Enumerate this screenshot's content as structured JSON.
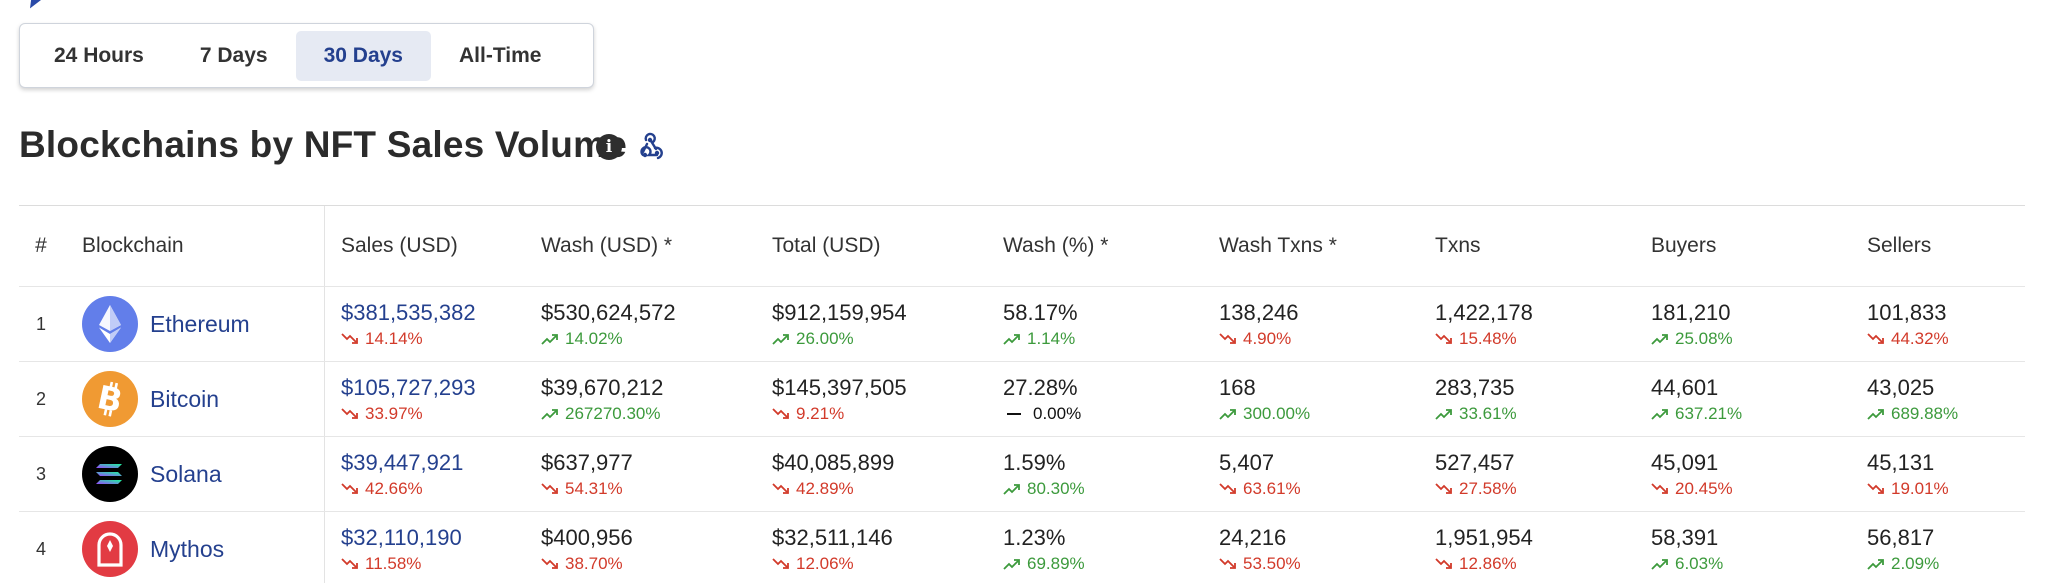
{
  "range_tabs": [
    {
      "label": "24 Hours",
      "active": false
    },
    {
      "label": "7 Days",
      "active": false
    },
    {
      "label": "30 Days",
      "active": true
    },
    {
      "label": "All-Time",
      "active": false
    }
  ],
  "section": {
    "title": "Blockchains by NFT Sales Volume",
    "info_icon": "info-icon",
    "webhook_icon": "webhook-icon"
  },
  "table": {
    "headers": {
      "rank": "#",
      "blockchain": "Blockchain",
      "sales": "Sales (USD)",
      "wash": "Wash (USD) *",
      "total": "Total (USD)",
      "wash_pct": "Wash (%) *",
      "wash_txns": "Wash Txns *",
      "txns": "Txns",
      "buyers": "Buyers",
      "sellers": "Sellers"
    },
    "rows": [
      {
        "rank": "1",
        "name": "Ethereum",
        "icon": "ethereum-icon",
        "color": "#627eea",
        "sales": {
          "v": "$381,535,382",
          "c": "14.14%",
          "d": "down"
        },
        "wash": {
          "v": "$530,624,572",
          "c": "14.02%",
          "d": "up"
        },
        "total": {
          "v": "$912,159,954",
          "c": "26.00%",
          "d": "up"
        },
        "wash_pct": {
          "v": "58.17%",
          "c": "1.14%",
          "d": "up"
        },
        "wash_txns": {
          "v": "138,246",
          "c": "4.90%",
          "d": "down"
        },
        "txns": {
          "v": "1,422,178",
          "c": "15.48%",
          "d": "down"
        },
        "buyers": {
          "v": "181,210",
          "c": "25.08%",
          "d": "up"
        },
        "sellers": {
          "v": "101,833",
          "c": "44.32%",
          "d": "down"
        }
      },
      {
        "rank": "2",
        "name": "Bitcoin",
        "icon": "bitcoin-icon",
        "color": "#f09a33",
        "sales": {
          "v": "$105,727,293",
          "c": "33.97%",
          "d": "down"
        },
        "wash": {
          "v": "$39,670,212",
          "c": "267270.30%",
          "d": "up"
        },
        "total": {
          "v": "$145,397,505",
          "c": "9.21%",
          "d": "down"
        },
        "wash_pct": {
          "v": "27.28%",
          "c": "0.00%",
          "d": "flat"
        },
        "wash_txns": {
          "v": "168",
          "c": "300.00%",
          "d": "up"
        },
        "txns": {
          "v": "283,735",
          "c": "33.61%",
          "d": "up"
        },
        "buyers": {
          "v": "44,601",
          "c": "637.21%",
          "d": "up"
        },
        "sellers": {
          "v": "43,025",
          "c": "689.88%",
          "d": "up"
        }
      },
      {
        "rank": "3",
        "name": "Solana",
        "icon": "solana-icon",
        "color": "#000000",
        "sales": {
          "v": "$39,447,921",
          "c": "42.66%",
          "d": "down"
        },
        "wash": {
          "v": "$637,977",
          "c": "54.31%",
          "d": "down"
        },
        "total": {
          "v": "$40,085,899",
          "c": "42.89%",
          "d": "down"
        },
        "wash_pct": {
          "v": "1.59%",
          "c": "80.30%",
          "d": "up"
        },
        "wash_txns": {
          "v": "5,407",
          "c": "63.61%",
          "d": "down"
        },
        "txns": {
          "v": "527,457",
          "c": "27.58%",
          "d": "down"
        },
        "buyers": {
          "v": "45,091",
          "c": "20.45%",
          "d": "down"
        },
        "sellers": {
          "v": "45,131",
          "c": "19.01%",
          "d": "down"
        }
      },
      {
        "rank": "4",
        "name": "Mythos",
        "icon": "mythos-icon",
        "color": "#e23b43",
        "sales": {
          "v": "$32,110,190",
          "c": "11.58%",
          "d": "down"
        },
        "wash": {
          "v": "$400,956",
          "c": "38.70%",
          "d": "down"
        },
        "total": {
          "v": "$32,511,146",
          "c": "12.06%",
          "d": "down"
        },
        "wash_pct": {
          "v": "1.23%",
          "c": "69.89%",
          "d": "up"
        },
        "wash_txns": {
          "v": "24,216",
          "c": "53.50%",
          "d": "down"
        },
        "txns": {
          "v": "1,951,954",
          "c": "12.86%",
          "d": "down"
        },
        "buyers": {
          "v": "58,391",
          "c": "6.03%",
          "d": "up"
        },
        "sellers": {
          "v": "56,817",
          "c": "2.09%",
          "d": "up"
        }
      }
    ]
  },
  "colors": {
    "accent": "#24408e",
    "up": "#3c9a3c",
    "down": "#d23a2a",
    "active_tab_bg": "#e6eaf3"
  }
}
